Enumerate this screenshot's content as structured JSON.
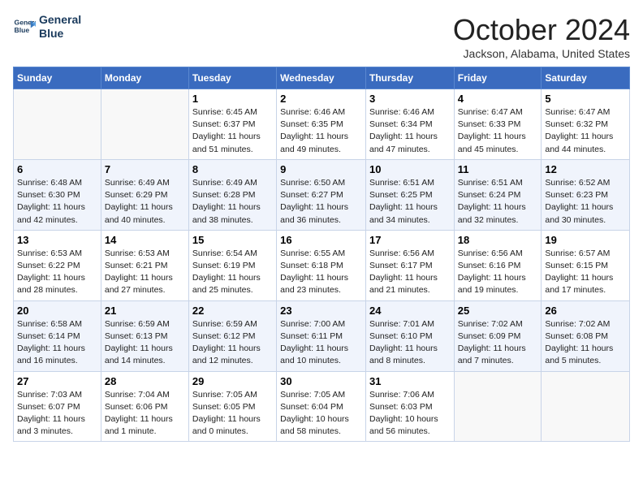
{
  "header": {
    "logo_line1": "General",
    "logo_line2": "Blue",
    "month_title": "October 2024",
    "location": "Jackson, Alabama, United States"
  },
  "weekdays": [
    "Sunday",
    "Monday",
    "Tuesday",
    "Wednesday",
    "Thursday",
    "Friday",
    "Saturday"
  ],
  "weeks": [
    [
      {
        "day": "",
        "sunrise": "",
        "sunset": "",
        "daylight": ""
      },
      {
        "day": "",
        "sunrise": "",
        "sunset": "",
        "daylight": ""
      },
      {
        "day": "1",
        "sunrise": "Sunrise: 6:45 AM",
        "sunset": "Sunset: 6:37 PM",
        "daylight": "Daylight: 11 hours and 51 minutes."
      },
      {
        "day": "2",
        "sunrise": "Sunrise: 6:46 AM",
        "sunset": "Sunset: 6:35 PM",
        "daylight": "Daylight: 11 hours and 49 minutes."
      },
      {
        "day": "3",
        "sunrise": "Sunrise: 6:46 AM",
        "sunset": "Sunset: 6:34 PM",
        "daylight": "Daylight: 11 hours and 47 minutes."
      },
      {
        "day": "4",
        "sunrise": "Sunrise: 6:47 AM",
        "sunset": "Sunset: 6:33 PM",
        "daylight": "Daylight: 11 hours and 45 minutes."
      },
      {
        "day": "5",
        "sunrise": "Sunrise: 6:47 AM",
        "sunset": "Sunset: 6:32 PM",
        "daylight": "Daylight: 11 hours and 44 minutes."
      }
    ],
    [
      {
        "day": "6",
        "sunrise": "Sunrise: 6:48 AM",
        "sunset": "Sunset: 6:30 PM",
        "daylight": "Daylight: 11 hours and 42 minutes."
      },
      {
        "day": "7",
        "sunrise": "Sunrise: 6:49 AM",
        "sunset": "Sunset: 6:29 PM",
        "daylight": "Daylight: 11 hours and 40 minutes."
      },
      {
        "day": "8",
        "sunrise": "Sunrise: 6:49 AM",
        "sunset": "Sunset: 6:28 PM",
        "daylight": "Daylight: 11 hours and 38 minutes."
      },
      {
        "day": "9",
        "sunrise": "Sunrise: 6:50 AM",
        "sunset": "Sunset: 6:27 PM",
        "daylight": "Daylight: 11 hours and 36 minutes."
      },
      {
        "day": "10",
        "sunrise": "Sunrise: 6:51 AM",
        "sunset": "Sunset: 6:25 PM",
        "daylight": "Daylight: 11 hours and 34 minutes."
      },
      {
        "day": "11",
        "sunrise": "Sunrise: 6:51 AM",
        "sunset": "Sunset: 6:24 PM",
        "daylight": "Daylight: 11 hours and 32 minutes."
      },
      {
        "day": "12",
        "sunrise": "Sunrise: 6:52 AM",
        "sunset": "Sunset: 6:23 PM",
        "daylight": "Daylight: 11 hours and 30 minutes."
      }
    ],
    [
      {
        "day": "13",
        "sunrise": "Sunrise: 6:53 AM",
        "sunset": "Sunset: 6:22 PM",
        "daylight": "Daylight: 11 hours and 28 minutes."
      },
      {
        "day": "14",
        "sunrise": "Sunrise: 6:53 AM",
        "sunset": "Sunset: 6:21 PM",
        "daylight": "Daylight: 11 hours and 27 minutes."
      },
      {
        "day": "15",
        "sunrise": "Sunrise: 6:54 AM",
        "sunset": "Sunset: 6:19 PM",
        "daylight": "Daylight: 11 hours and 25 minutes."
      },
      {
        "day": "16",
        "sunrise": "Sunrise: 6:55 AM",
        "sunset": "Sunset: 6:18 PM",
        "daylight": "Daylight: 11 hours and 23 minutes."
      },
      {
        "day": "17",
        "sunrise": "Sunrise: 6:56 AM",
        "sunset": "Sunset: 6:17 PM",
        "daylight": "Daylight: 11 hours and 21 minutes."
      },
      {
        "day": "18",
        "sunrise": "Sunrise: 6:56 AM",
        "sunset": "Sunset: 6:16 PM",
        "daylight": "Daylight: 11 hours and 19 minutes."
      },
      {
        "day": "19",
        "sunrise": "Sunrise: 6:57 AM",
        "sunset": "Sunset: 6:15 PM",
        "daylight": "Daylight: 11 hours and 17 minutes."
      }
    ],
    [
      {
        "day": "20",
        "sunrise": "Sunrise: 6:58 AM",
        "sunset": "Sunset: 6:14 PM",
        "daylight": "Daylight: 11 hours and 16 minutes."
      },
      {
        "day": "21",
        "sunrise": "Sunrise: 6:59 AM",
        "sunset": "Sunset: 6:13 PM",
        "daylight": "Daylight: 11 hours and 14 minutes."
      },
      {
        "day": "22",
        "sunrise": "Sunrise: 6:59 AM",
        "sunset": "Sunset: 6:12 PM",
        "daylight": "Daylight: 11 hours and 12 minutes."
      },
      {
        "day": "23",
        "sunrise": "Sunrise: 7:00 AM",
        "sunset": "Sunset: 6:11 PM",
        "daylight": "Daylight: 11 hours and 10 minutes."
      },
      {
        "day": "24",
        "sunrise": "Sunrise: 7:01 AM",
        "sunset": "Sunset: 6:10 PM",
        "daylight": "Daylight: 11 hours and 8 minutes."
      },
      {
        "day": "25",
        "sunrise": "Sunrise: 7:02 AM",
        "sunset": "Sunset: 6:09 PM",
        "daylight": "Daylight: 11 hours and 7 minutes."
      },
      {
        "day": "26",
        "sunrise": "Sunrise: 7:02 AM",
        "sunset": "Sunset: 6:08 PM",
        "daylight": "Daylight: 11 hours and 5 minutes."
      }
    ],
    [
      {
        "day": "27",
        "sunrise": "Sunrise: 7:03 AM",
        "sunset": "Sunset: 6:07 PM",
        "daylight": "Daylight: 11 hours and 3 minutes."
      },
      {
        "day": "28",
        "sunrise": "Sunrise: 7:04 AM",
        "sunset": "Sunset: 6:06 PM",
        "daylight": "Daylight: 11 hours and 1 minute."
      },
      {
        "day": "29",
        "sunrise": "Sunrise: 7:05 AM",
        "sunset": "Sunset: 6:05 PM",
        "daylight": "Daylight: 11 hours and 0 minutes."
      },
      {
        "day": "30",
        "sunrise": "Sunrise: 7:05 AM",
        "sunset": "Sunset: 6:04 PM",
        "daylight": "Daylight: 10 hours and 58 minutes."
      },
      {
        "day": "31",
        "sunrise": "Sunrise: 7:06 AM",
        "sunset": "Sunset: 6:03 PM",
        "daylight": "Daylight: 10 hours and 56 minutes."
      },
      {
        "day": "",
        "sunrise": "",
        "sunset": "",
        "daylight": ""
      },
      {
        "day": "",
        "sunrise": "",
        "sunset": "",
        "daylight": ""
      }
    ]
  ]
}
